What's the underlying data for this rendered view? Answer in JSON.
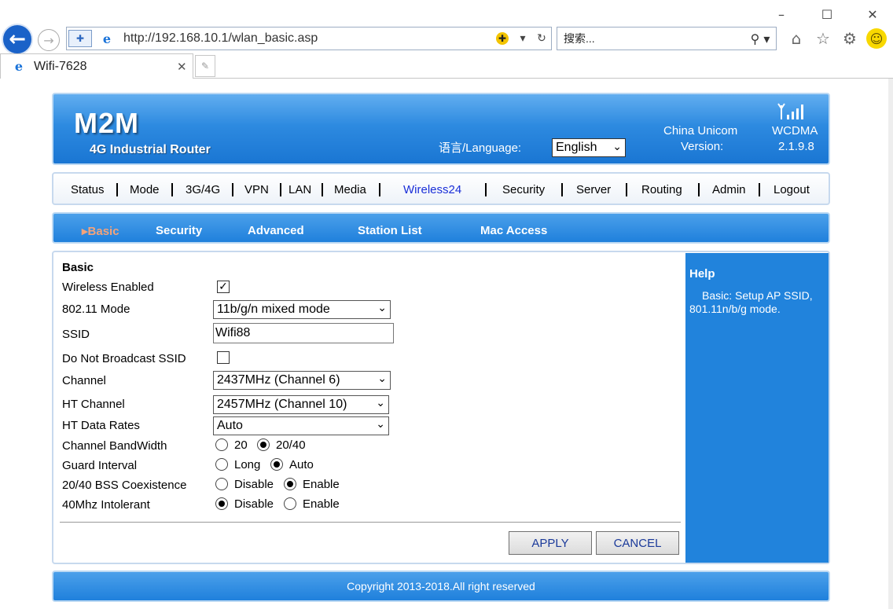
{
  "browser": {
    "url": "http://192.168.10.1/wlan_basic.asp",
    "search_placeholder": "搜索...",
    "tab_title": "Wifi-7628",
    "window_controls": [
      "minimize-icon",
      "maximize-icon",
      "close-icon"
    ],
    "toolbar_icons": [
      "home-icon",
      "star-icon",
      "gear-icon",
      "smiley-icon"
    ]
  },
  "header": {
    "logo": "M2M",
    "slogan": "4G Industrial Router",
    "language_label": "语言/Language:",
    "language_value": "English",
    "carrier": "China Unicom",
    "version_label": "Version:",
    "network": "WCDMA",
    "version": "2.1.9.8"
  },
  "nav": {
    "items": [
      "Status",
      "Mode",
      "3G/4G",
      "VPN",
      "LAN",
      "Media",
      "Wireless24",
      "Security",
      "Server",
      "Routing",
      "Admin",
      "Logout"
    ],
    "active": "Wireless24"
  },
  "subnav": {
    "items": [
      "Basic",
      "Security",
      "Advanced",
      "Station List",
      "Mac Access"
    ],
    "active": "Basic"
  },
  "form": {
    "section_title": "Basic",
    "wireless_enabled_label": "Wireless Enabled",
    "wireless_enabled": true,
    "mode_label": "802.11 Mode",
    "mode_value": "11b/g/n mixed mode",
    "ssid_label": "SSID",
    "ssid_value": "Wifi88",
    "hide_ssid_label": "Do Not Broadcast SSID",
    "hide_ssid": false,
    "channel_label": "Channel",
    "channel_value": "2437MHz (Channel 6)",
    "ht_channel_label": "HT Channel",
    "ht_channel_value": "2457MHz (Channel 10)",
    "ht_rates_label": "HT Data Rates",
    "ht_rates_value": "Auto",
    "bandwidth_label": "Channel BandWidth",
    "bandwidth_options": [
      "20",
      "20/40"
    ],
    "bandwidth_selected": "20/40",
    "guard_label": "Guard Interval",
    "guard_options": [
      "Long",
      "Auto"
    ],
    "guard_selected": "Auto",
    "coexist_label": "20/40 BSS Coexistence",
    "coexist_options": [
      "Disable",
      "Enable"
    ],
    "coexist_selected": "Enable",
    "intolerant_label": "40Mhz Intolerant",
    "intolerant_options": [
      "Disable",
      "Enable"
    ],
    "intolerant_selected": "Disable",
    "apply_label": "APPLY",
    "cancel_label": "CANCEL"
  },
  "help": {
    "title": "Help",
    "text": "Basic: Setup AP SSID, 801.11n/b/g mode."
  },
  "footer": {
    "copyright": "Copyright 2013-2018.All right reserved"
  }
}
